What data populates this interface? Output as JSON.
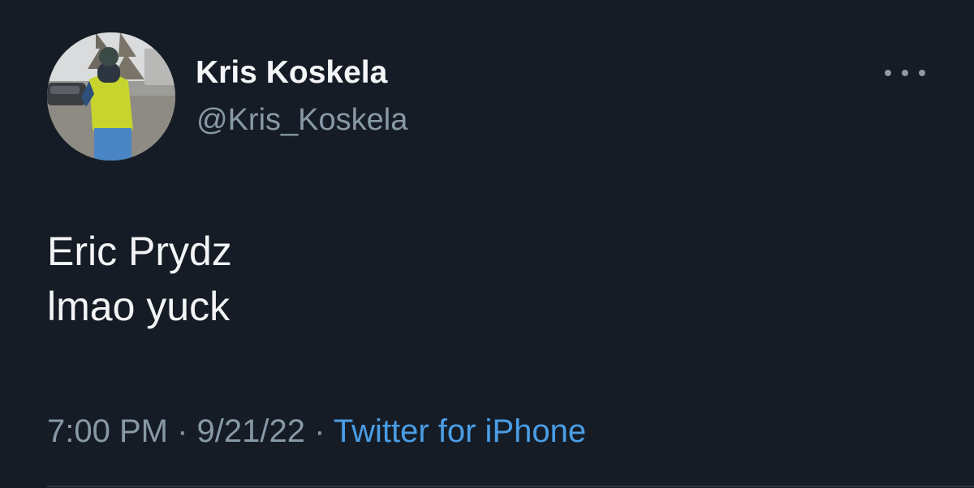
{
  "author": {
    "display_name": "Kris Koskela",
    "handle": "@Kris_Koskela",
    "avatar_icon": "profile-photo"
  },
  "more_icon": "more-horizontal-icon",
  "tweet": {
    "lines": [
      "Eric Prydz",
      "lmao yuck"
    ]
  },
  "meta": {
    "time": "7:00 PM",
    "separator": "·",
    "date": "9/21/22",
    "source": "Twitter for iPhone"
  },
  "colors": {
    "background": "#161c26",
    "text_primary": "#f3f4f5",
    "text_secondary": "#8899a6",
    "link": "#4a9ee6"
  }
}
